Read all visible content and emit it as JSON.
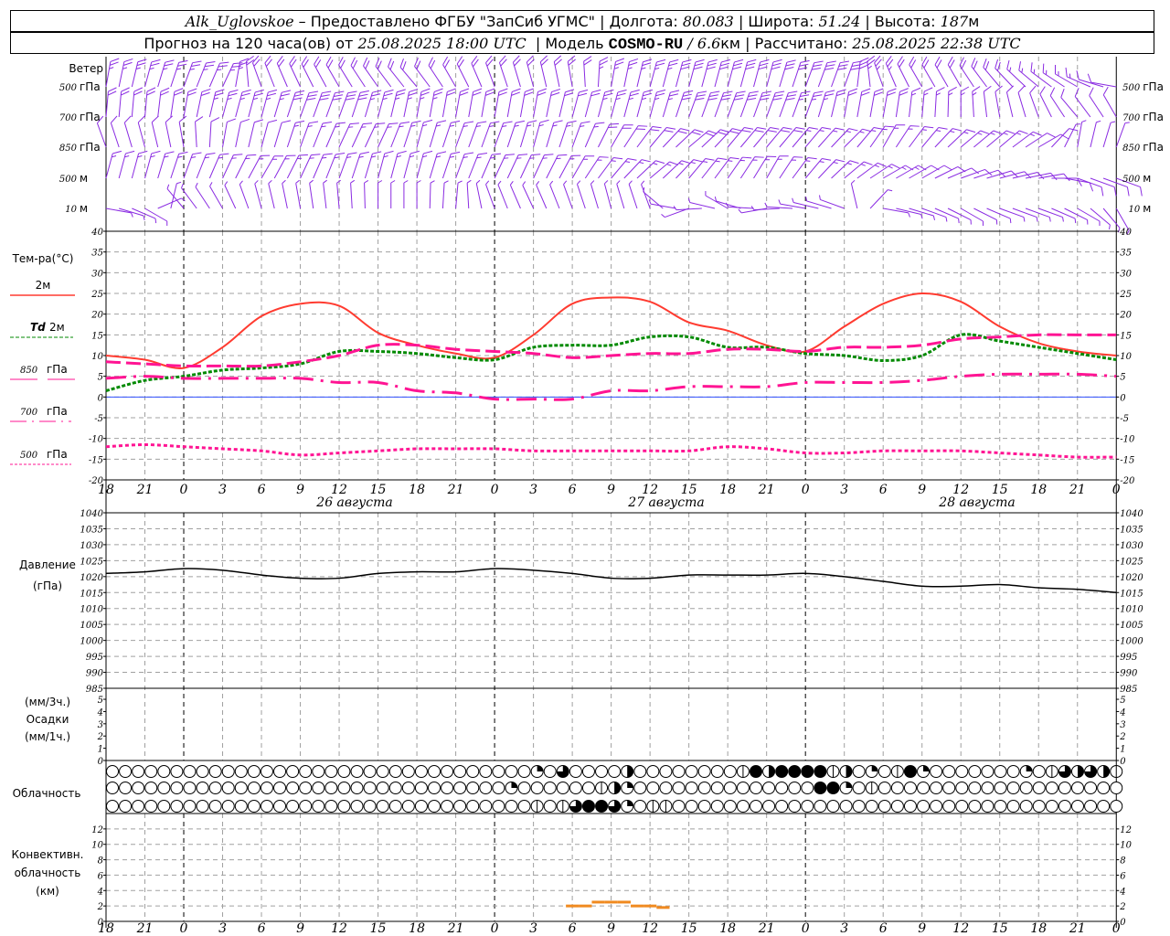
{
  "header": {
    "station": "Alk_Uglovskoe",
    "provider": " – Предоставлено ФГБУ \"ЗапСиб УГМС\" | Долгота: ",
    "lon": "80.083",
    "lat_label": " | Широта: ",
    "lat": "51.24",
    "alt_label": " | Высота: ",
    "alt": "187",
    "alt_unit": "м",
    "forecast_label": "Прогноз на 120 часа(ов) от ",
    "forecast_start": "25.08.2025 18:00 UTC",
    "model_label": "  | Модель ",
    "model": "COSMO-RU",
    "model_sep": " / ",
    "resolution": "6.6",
    "res_unit": "км",
    "calc_label": " | Рассчитано: ",
    "calc_time": "25.08.2025 22:38 UTC"
  },
  "colors": {
    "t2m": "#ff3b30",
    "td2m": "#008a00",
    "t850": "#ff1493",
    "t700": "#ff1493",
    "t500": "#ff1493",
    "zero": "#3050ff",
    "wind": "#8a2be2",
    "conv": "#f08a20",
    "grid": "#a0a0a0"
  },
  "wind_panel": {
    "title": "Ветер",
    "levels": [
      {
        "label_num": "500",
        "label_unit": "гПа",
        "dir": [
          10,
          15,
          20,
          25,
          340,
          335,
          330,
          325,
          320,
          330,
          340,
          345,
          350,
          10,
          15,
          15,
          15,
          15,
          20,
          20,
          340,
          330,
          330,
          320,
          310,
          300,
          280
        ],
        "speed_kt": [
          25,
          25,
          25,
          25,
          20,
          20,
          20,
          20,
          20,
          20,
          20,
          20,
          20,
          25,
          25,
          30,
          30,
          30,
          30,
          30,
          25,
          20,
          20,
          20,
          15,
          15,
          10
        ]
      },
      {
        "label_num": "700",
        "label_unit": "гПа",
        "dir": [
          5,
          5,
          10,
          15,
          15,
          20,
          20,
          15,
          10,
          10,
          10,
          10,
          15,
          15,
          15,
          20,
          20,
          20,
          20,
          10,
          10,
          5,
          0,
          350,
          340,
          320,
          330
        ],
        "speed_kt": [
          20,
          20,
          20,
          25,
          25,
          30,
          30,
          25,
          25,
          20,
          20,
          20,
          20,
          25,
          25,
          30,
          30,
          30,
          25,
          20,
          20,
          15,
          15,
          10,
          10,
          10,
          10
        ]
      },
      {
        "label_num": "850",
        "label_unit": "гПа",
        "dir": [
          340,
          345,
          350,
          10,
          15,
          20,
          25,
          25,
          15,
          20,
          20,
          15,
          20,
          30,
          40,
          50,
          40,
          40,
          40,
          45,
          30,
          40,
          50,
          50,
          60,
          10,
          20
        ],
        "speed_kt": [
          10,
          10,
          10,
          10,
          10,
          15,
          15,
          15,
          15,
          15,
          15,
          15,
          15,
          20,
          20,
          20,
          20,
          20,
          15,
          15,
          15,
          15,
          15,
          15,
          10,
          5,
          5
        ]
      },
      {
        "label_num": "500",
        "label_unit": "м",
        "dir": [
          15,
          15,
          20,
          25,
          30,
          25,
          20,
          15,
          15,
          20,
          25,
          25,
          30,
          40,
          50,
          40,
          35,
          30,
          40,
          50,
          60,
          60,
          70,
          75,
          80,
          110,
          110
        ],
        "speed_kt": [
          15,
          15,
          15,
          15,
          15,
          15,
          15,
          15,
          15,
          15,
          15,
          15,
          15,
          15,
          15,
          15,
          15,
          15,
          15,
          15,
          15,
          10,
          10,
          10,
          10,
          10,
          10
        ]
      },
      {
        "label_num": "10",
        "label_unit": "м",
        "dir": [
          100,
          120,
          320,
          330,
          345,
          350,
          355,
          0,
          0,
          5,
          340,
          335,
          340,
          345,
          340,
          250,
          300,
          260,
          280,
          290,
          100,
          110,
          120,
          110,
          110,
          120,
          150
        ],
        "speed_kt": [
          5,
          5,
          5,
          5,
          5,
          5,
          5,
          5,
          5,
          5,
          5,
          5,
          5,
          5,
          5,
          5,
          5,
          5,
          5,
          5,
          5,
          5,
          5,
          5,
          5,
          5,
          5
        ]
      }
    ]
  },
  "time_axis": {
    "times": [
      "25.08 18:00",
      "25.08 21:00",
      "26.08 00:00",
      "26.08 03:00",
      "26.08 06:00",
      "26.08 09:00",
      "26.08 12:00",
      "26.08 15:00",
      "26.08 18:00",
      "26.08 21:00",
      "27.08 00:00",
      "27.08 03:00",
      "27.08 06:00",
      "27.08 09:00",
      "27.08 12:00",
      "27.08 15:00",
      "27.08 18:00",
      "27.08 21:00",
      "28.08 00:00",
      "28.08 03:00",
      "28.08 06:00",
      "28.08 09:00",
      "28.08 12:00",
      "28.08 15:00",
      "28.08 18:00",
      "28.08 21:00",
      "29.08 00:00"
    ],
    "tick_labels": [
      "18",
      "21",
      "0",
      "3",
      "6",
      "9",
      "12",
      "15",
      "18",
      "21",
      "0",
      "3",
      "6",
      "9",
      "12",
      "15",
      "18",
      "21",
      "0",
      "3",
      "6",
      "9",
      "12",
      "15",
      "18",
      "21",
      "0"
    ],
    "date_labels": [
      "26  августа",
      "27  августа",
      "28  августа"
    ]
  },
  "chart_data": [
    {
      "type": "line",
      "title": "Тем-ра(°C)",
      "ylim": [
        -20,
        40
      ],
      "yticks": [
        40,
        35,
        30,
        25,
        20,
        15,
        10,
        5,
        0,
        -5,
        -10,
        -15,
        -20
      ],
      "grid": true,
      "series": [
        {
          "key": "t2m",
          "name": "2м",
          "values": [
            10,
            9,
            7,
            12,
            19.5,
            22.5,
            22,
            15.5,
            12.5,
            10.5,
            9.5,
            15,
            22.5,
            24,
            23,
            18,
            16,
            12.5,
            11,
            17,
            22.5,
            25,
            23,
            17,
            13,
            11,
            10
          ]
        },
        {
          "key": "td2m",
          "name_prefix": "Td",
          "name": "2м",
          "values": [
            1.5,
            4,
            5,
            6.5,
            7,
            8,
            11,
            11,
            10.5,
            9.5,
            9,
            12,
            12.5,
            12.5,
            14.5,
            14.5,
            12,
            12,
            10.5,
            10,
            8.8,
            10,
            15,
            13.5,
            12,
            10.5,
            9
          ]
        },
        {
          "key": "t850",
          "name_num": "850",
          "name": "гПа",
          "values": [
            8.5,
            8,
            7.5,
            7.5,
            7.5,
            8.5,
            10,
            12.5,
            12.5,
            11.5,
            11,
            10.5,
            9.5,
            10,
            10.5,
            10.5,
            11.5,
            11.5,
            11,
            12,
            12,
            12.5,
            14,
            14.5,
            15,
            15,
            15
          ]
        },
        {
          "key": "t700",
          "name_num": "700",
          "name": "гПа",
          "values": [
            4.5,
            5,
            4.5,
            4.5,
            4.5,
            4.5,
            3.5,
            3.5,
            1.5,
            1,
            -0.5,
            -0.5,
            -0.5,
            1.5,
            1.5,
            2.5,
            2.5,
            2.5,
            3.5,
            3.5,
            3.5,
            4,
            5,
            5.5,
            5.5,
            5.5,
            5
          ]
        },
        {
          "key": "t500",
          "name_num": "500",
          "name": "гПа",
          "values": [
            -12,
            -11.5,
            -12,
            -12.5,
            -13,
            -14,
            -13.5,
            -13,
            -12.5,
            -12.5,
            -12.5,
            -13,
            -13,
            -13,
            -13,
            -13,
            -12,
            -12.5,
            -13.5,
            -13.5,
            -13,
            -13,
            -13,
            -13.5,
            -14,
            -14.5,
            -14.5
          ]
        }
      ]
    },
    {
      "type": "line",
      "title": "Давление",
      "ylabel": "(гПа)",
      "ylim": [
        985,
        1040
      ],
      "yticks": [
        1040,
        1035,
        1030,
        1025,
        1020,
        1015,
        1010,
        1005,
        1000,
        995,
        990,
        985
      ],
      "grid": true,
      "series": [
        {
          "key": "pressure",
          "values": [
            1021,
            1021.5,
            1022.5,
            1022,
            1020.5,
            1019.5,
            1019.5,
            1021,
            1021.5,
            1021.5,
            1022.5,
            1022,
            1021,
            1019.5,
            1019.5,
            1020.5,
            1020.5,
            1020.5,
            1021,
            1020,
            1018.5,
            1017,
            1017,
            1017.5,
            1016.5,
            1016,
            1015
          ]
        }
      ]
    },
    {
      "type": "bar",
      "title": "Осадки",
      "ylabel_top": "(мм/3ч.)",
      "ylabel_bottom": "(мм/1ч.)",
      "ylim": [
        0,
        5
      ],
      "yticks": [
        5,
        4,
        3,
        2,
        1,
        0
      ],
      "values": []
    },
    {
      "type": "table",
      "title": "Облачность",
      "note": "cloud cover in oktas, hourly from 25.08 18:00",
      "rows": [
        "0000000000000000000000000000000002060000400000000184888814020182000000020164641",
        "0000000000000000000000000000000200000014200000000000000882010000000000000000000",
        "0000000000000000000000000000000001016886201100000000000000000000000000000000000"
      ]
    },
    {
      "type": "bar",
      "title_lines": [
        "Конвективн.",
        "облачность",
        "(км)"
      ],
      "ylim": [
        0,
        13
      ],
      "yticks": [
        12,
        10,
        8,
        6,
        4,
        2,
        0
      ],
      "grid": true,
      "points": [
        {
          "time": "27.08 06:00",
          "top_km": 2.0
        },
        {
          "time": "27.08 07:00",
          "top_km": 2.0
        },
        {
          "time": "27.08 08:00",
          "top_km": 2.5
        },
        {
          "time": "27.08 09:00",
          "top_km": 2.5
        },
        {
          "time": "27.08 10:00",
          "top_km": 2.5
        },
        {
          "time": "27.08 11:00",
          "top_km": 2.0
        },
        {
          "time": "27.08 12:00",
          "top_km": 2.0
        },
        {
          "time": "27.08 13:00",
          "top_km": 1.8
        }
      ]
    }
  ]
}
